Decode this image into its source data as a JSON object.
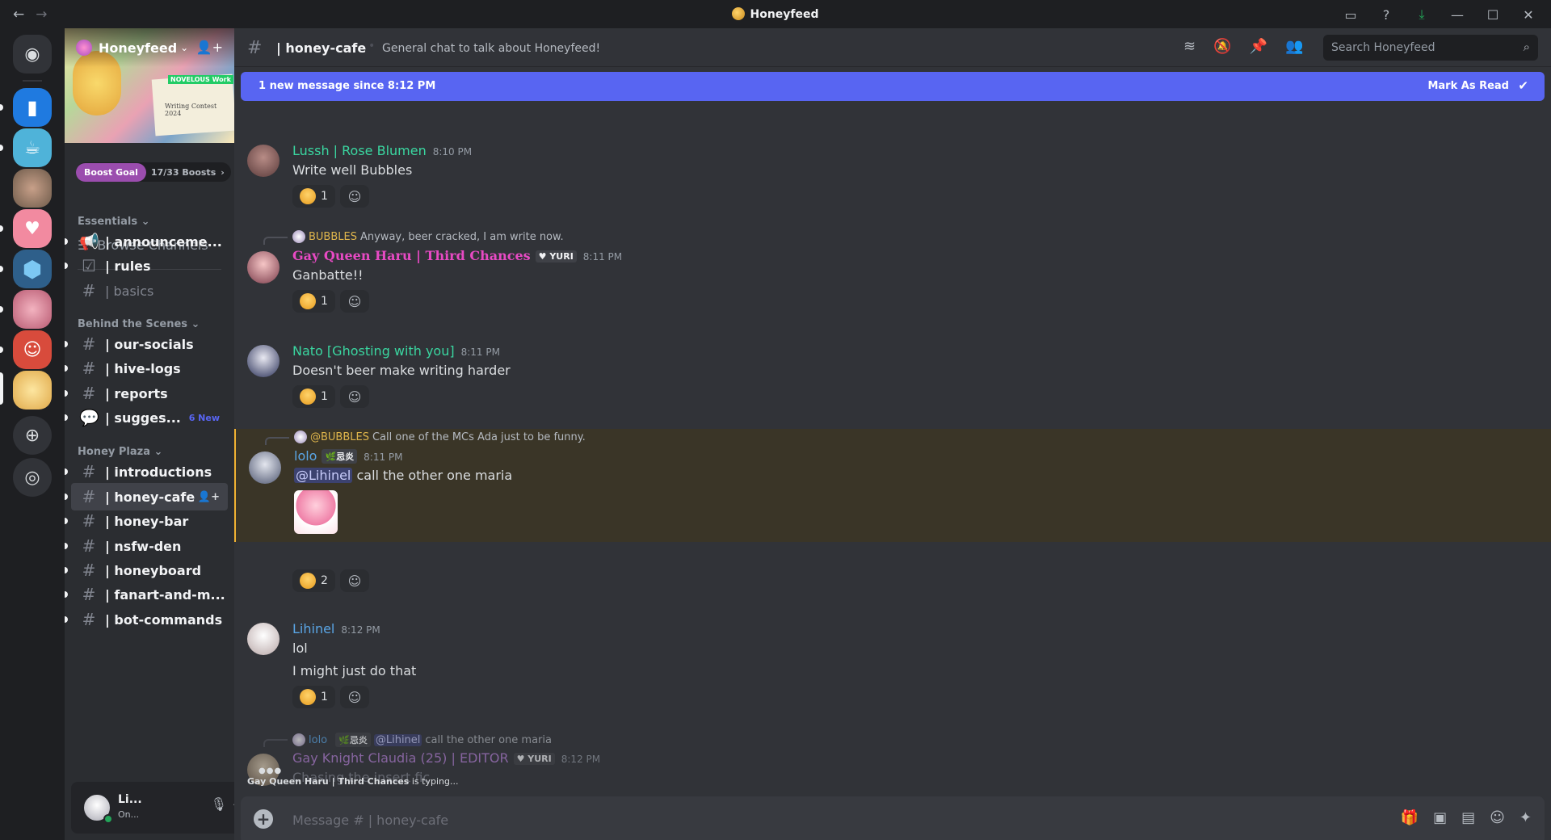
{
  "titlebar": {
    "title": "Honeyfeed",
    "back": "←",
    "forward": "→"
  },
  "rail": {
    "servers": [
      {
        "name": "home-discord",
        "color": "#313338",
        "glyph": "◉"
      },
      {
        "name": "server-blue-book",
        "color": "#1f7ae0",
        "glyph": "▮"
      },
      {
        "name": "server-cafe-cup",
        "color": "#4fb3d9",
        "glyph": "☕"
      },
      {
        "name": "server-anime-duo",
        "color": "#6d5a4a",
        "glyph": ""
      },
      {
        "name": "server-pink-mug",
        "color": "#f28aa0",
        "glyph": "♥"
      },
      {
        "name": "server-hexagon",
        "color": "#2e5f8a",
        "glyph": "⬢"
      },
      {
        "name": "server-pink-art",
        "color": "#d9798c",
        "glyph": ""
      },
      {
        "name": "server-robot",
        "color": "#d84b3c",
        "glyph": "☺"
      },
      {
        "name": "server-honeyfeed",
        "color": "#f3c46b",
        "glyph": ""
      }
    ]
  },
  "guild": {
    "name": "Honeyfeed",
    "banner_tag": "NOVELOUS Work",
    "banner_text": "Writing Contest 2024",
    "boost": {
      "goal": "Boost Goal",
      "count": "17/33 Boosts",
      "chevron": "›"
    },
    "browse": "Browse Channels",
    "categories": [
      {
        "label": "Essentials ⌄"
      },
      {
        "label": "Behind the Scenes ⌄"
      },
      {
        "label": "Honey Plaza ⌄"
      }
    ],
    "channels": [
      {
        "icon": "📢",
        "label": "| announceme...",
        "unread": true
      },
      {
        "icon": "☑",
        "label": "| rules",
        "unread": true
      },
      {
        "icon": "#",
        "label": "| basics",
        "muted": true
      },
      {
        "icon": "#",
        "label": "| our-socials",
        "unread": true
      },
      {
        "icon": "#",
        "label": "| hive-logs",
        "unread": true
      },
      {
        "icon": "#",
        "label": "| reports",
        "unread": true
      },
      {
        "icon": "💬",
        "label": "| sugges...",
        "unread": true,
        "badge": "6 New"
      },
      {
        "icon": "#",
        "label": "| introductions",
        "unread": true
      },
      {
        "icon": "#",
        "label": "| honey-cafe",
        "active": true
      },
      {
        "icon": "#",
        "label": "| honey-bar",
        "unread": true
      },
      {
        "icon": "#",
        "label": "| nsfw-den",
        "unread": true
      },
      {
        "icon": "#",
        "label": "| honeyboard",
        "unread": true
      },
      {
        "icon": "#",
        "label": "| fanart-and-m...",
        "unread": true
      },
      {
        "icon": "#",
        "label": "| bot-commands",
        "unread": true
      }
    ]
  },
  "user": {
    "name": "Li...",
    "status": "On..."
  },
  "channel": {
    "hash": "#",
    "name": "| honey-cafe",
    "sep": "•",
    "topic": "General chat to talk about Honeyfeed!",
    "search_placeholder": "Search Honeyfeed"
  },
  "newbar": {
    "text": "1 new message since 8:12 PM",
    "action": "Mark As Read"
  },
  "messages": [
    {
      "name": "Lussh | Rose Blumen",
      "color": "#3ad6a0",
      "time": "8:10 PM",
      "text": "Write well Bubbles",
      "reaction_count": "1"
    },
    {
      "reply_name": "BUBBLES",
      "reply_color": "#e0b64c",
      "reply_text": "Anyway, beer cracked, I am write now.",
      "name": "Gay Queen Haru | Third Chances",
      "color": "#e84ac4",
      "tag": "♥ YURI",
      "time": "8:11 PM",
      "text": "Ganbatte!!",
      "reaction_count": "1"
    },
    {
      "name": "Nato [Ghosting with you]",
      "color": "#3ad6a0",
      "time": "8:11 PM",
      "text": "Doesn't beer make writing harder",
      "reaction_count": "1"
    },
    {
      "reply_name": "@BUBBLES",
      "reply_color": "#e0b64c",
      "reply_text": "Call one of the MCs Ada just to be funny.",
      "name": "lolo",
      "color": "#5aa6e6",
      "tag": "🌿忌炎",
      "time": "8:11 PM",
      "mention": "@Lihinel",
      "text": "call the other one maria",
      "reaction_count": "2"
    },
    {
      "name": "Lihinel",
      "color": "#5aa6e6",
      "time": "8:12 PM",
      "text": "lol",
      "text2": "I might just do that",
      "reaction_count": "1"
    },
    {
      "reply_name": "lolo",
      "reply_color": "#5aa6e6",
      "reply_tag": "🌿忌炎",
      "reply_mention": "@Lihinel",
      "reply_text": "call the other one maria",
      "name": "Gay Knight Claudia (25) | EDITOR",
      "color": "#b47fd6",
      "tag": "♥ YURI",
      "time": "8:12 PM",
      "text": "Chasing the insert fic"
    }
  ],
  "typing": {
    "who": "Gay Queen Haru | Third Chances",
    "suffix": " is typing..."
  },
  "composer": {
    "placeholder": "Message # | honey-cafe",
    "plus": "+"
  }
}
